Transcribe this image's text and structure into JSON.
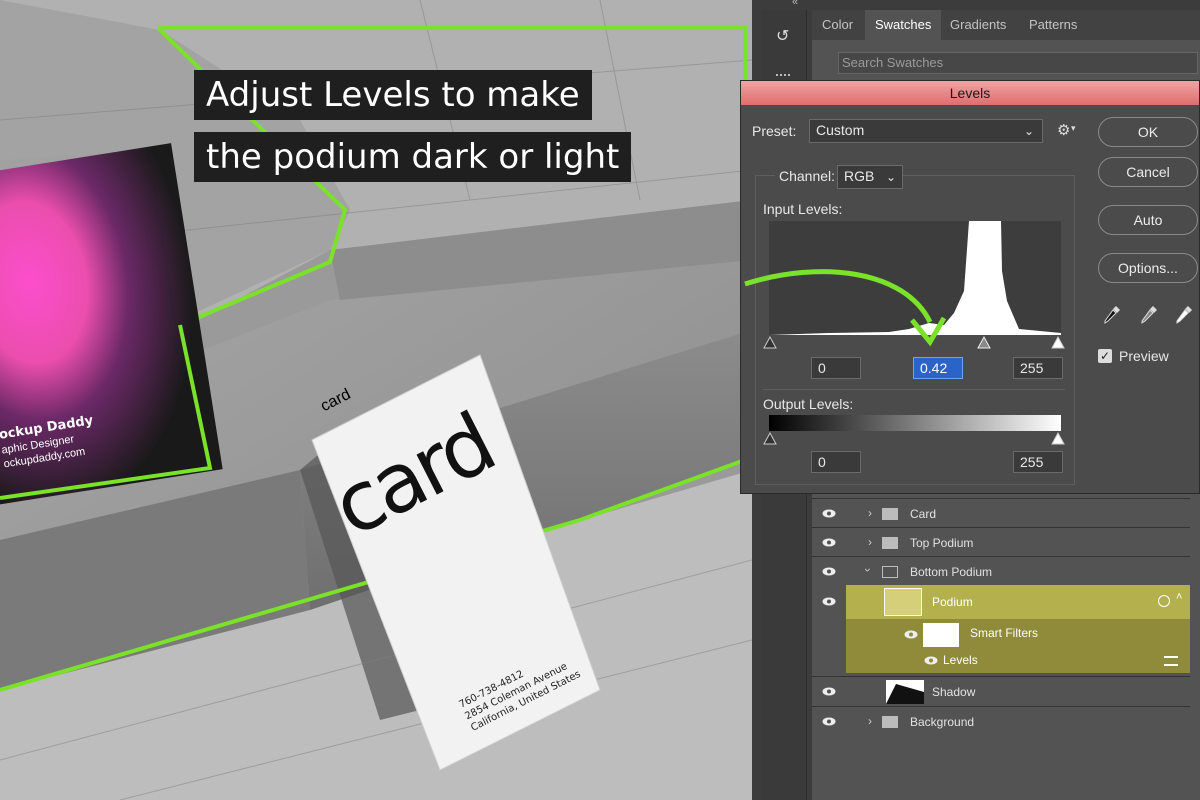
{
  "caption": {
    "line1": "Adjust Levels to make",
    "line2": "the podium dark or light"
  },
  "card_front": {
    "name": "ockup Daddy",
    "role": "aphic Designer",
    "site": "ockupdaddy.com"
  },
  "card_back": {
    "logo": "card",
    "phone": "760-738-4812",
    "street": "2854 Coleman Avenue",
    "city": "California, United States"
  },
  "tabs": [
    "Color",
    "Swatches",
    "Gradients",
    "Patterns"
  ],
  "active_tab": "Swatches",
  "search_placeholder": "Search Swatches",
  "levels": {
    "title": "Levels",
    "preset_label": "Preset:",
    "preset_value": "Custom",
    "channel_label": "Channel:",
    "channel_value": "RGB",
    "input_levels_label": "Input Levels:",
    "input_black": "0",
    "input_gamma": "0.42",
    "input_white": "255",
    "output_levels_label": "Output Levels:",
    "output_black": "0",
    "output_white": "255",
    "ok_label": "OK",
    "cancel_label": "Cancel",
    "auto_label": "Auto",
    "options_label": "Options...",
    "preview_label": "Preview",
    "preview_checked": true
  },
  "layers": [
    {
      "name": "Card",
      "type": "group",
      "expanded": false
    },
    {
      "name": "Top Podium",
      "type": "group",
      "expanded": false
    },
    {
      "name": "Bottom Podium",
      "type": "group",
      "expanded": true
    },
    {
      "name": "Podium",
      "type": "smart-object",
      "selected": true
    },
    {
      "name": "Smart Filters",
      "type": "filter-mask"
    },
    {
      "name": "Levels",
      "type": "filter"
    },
    {
      "name": "Shadow",
      "type": "layer"
    },
    {
      "name": "Background",
      "type": "group",
      "expanded": false
    }
  ],
  "colors": {
    "accent_green": "#7be22a",
    "selection": "#b5b04e",
    "dialog_title": "#e57d7d"
  }
}
